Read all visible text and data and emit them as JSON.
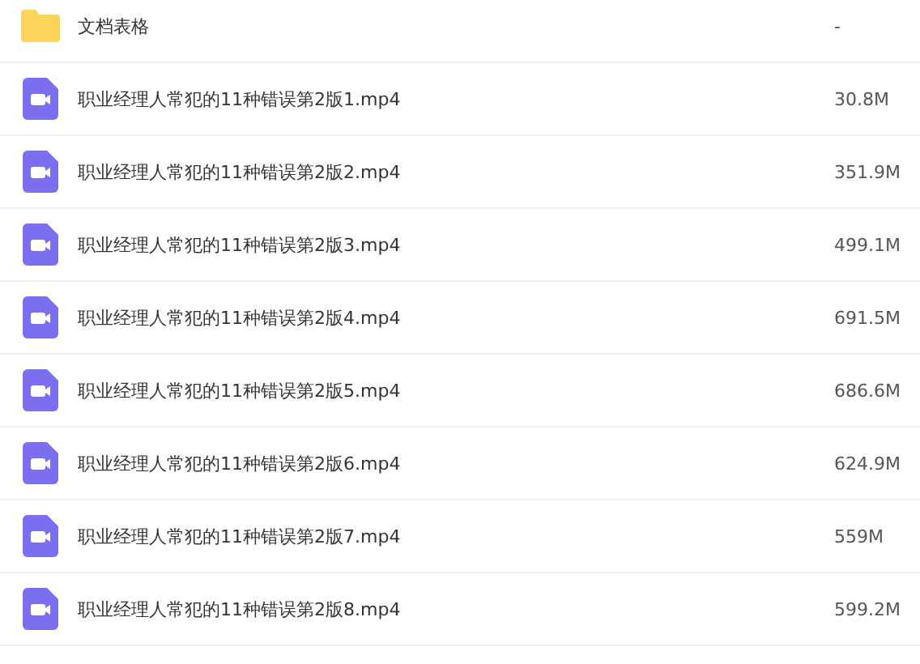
{
  "files": [
    {
      "kind": "folder",
      "name": "文档表格",
      "size": "-"
    },
    {
      "kind": "video",
      "name": "职业经理人常犯的11种错误第2版1.mp4",
      "size": "30.8M"
    },
    {
      "kind": "video",
      "name": "职业经理人常犯的11种错误第2版2.mp4",
      "size": "351.9M"
    },
    {
      "kind": "video",
      "name": "职业经理人常犯的11种错误第2版3.mp4",
      "size": "499.1M"
    },
    {
      "kind": "video",
      "name": "职业经理人常犯的11种错误第2版4.mp4",
      "size": "691.5M"
    },
    {
      "kind": "video",
      "name": "职业经理人常犯的11种错误第2版5.mp4",
      "size": "686.6M"
    },
    {
      "kind": "video",
      "name": "职业经理人常犯的11种错误第2版6.mp4",
      "size": "624.9M"
    },
    {
      "kind": "video",
      "name": "职业经理人常犯的11种错误第2版7.mp4",
      "size": "559M"
    },
    {
      "kind": "video",
      "name": "职业经理人常犯的11种错误第2版8.mp4",
      "size": "599.2M"
    }
  ]
}
